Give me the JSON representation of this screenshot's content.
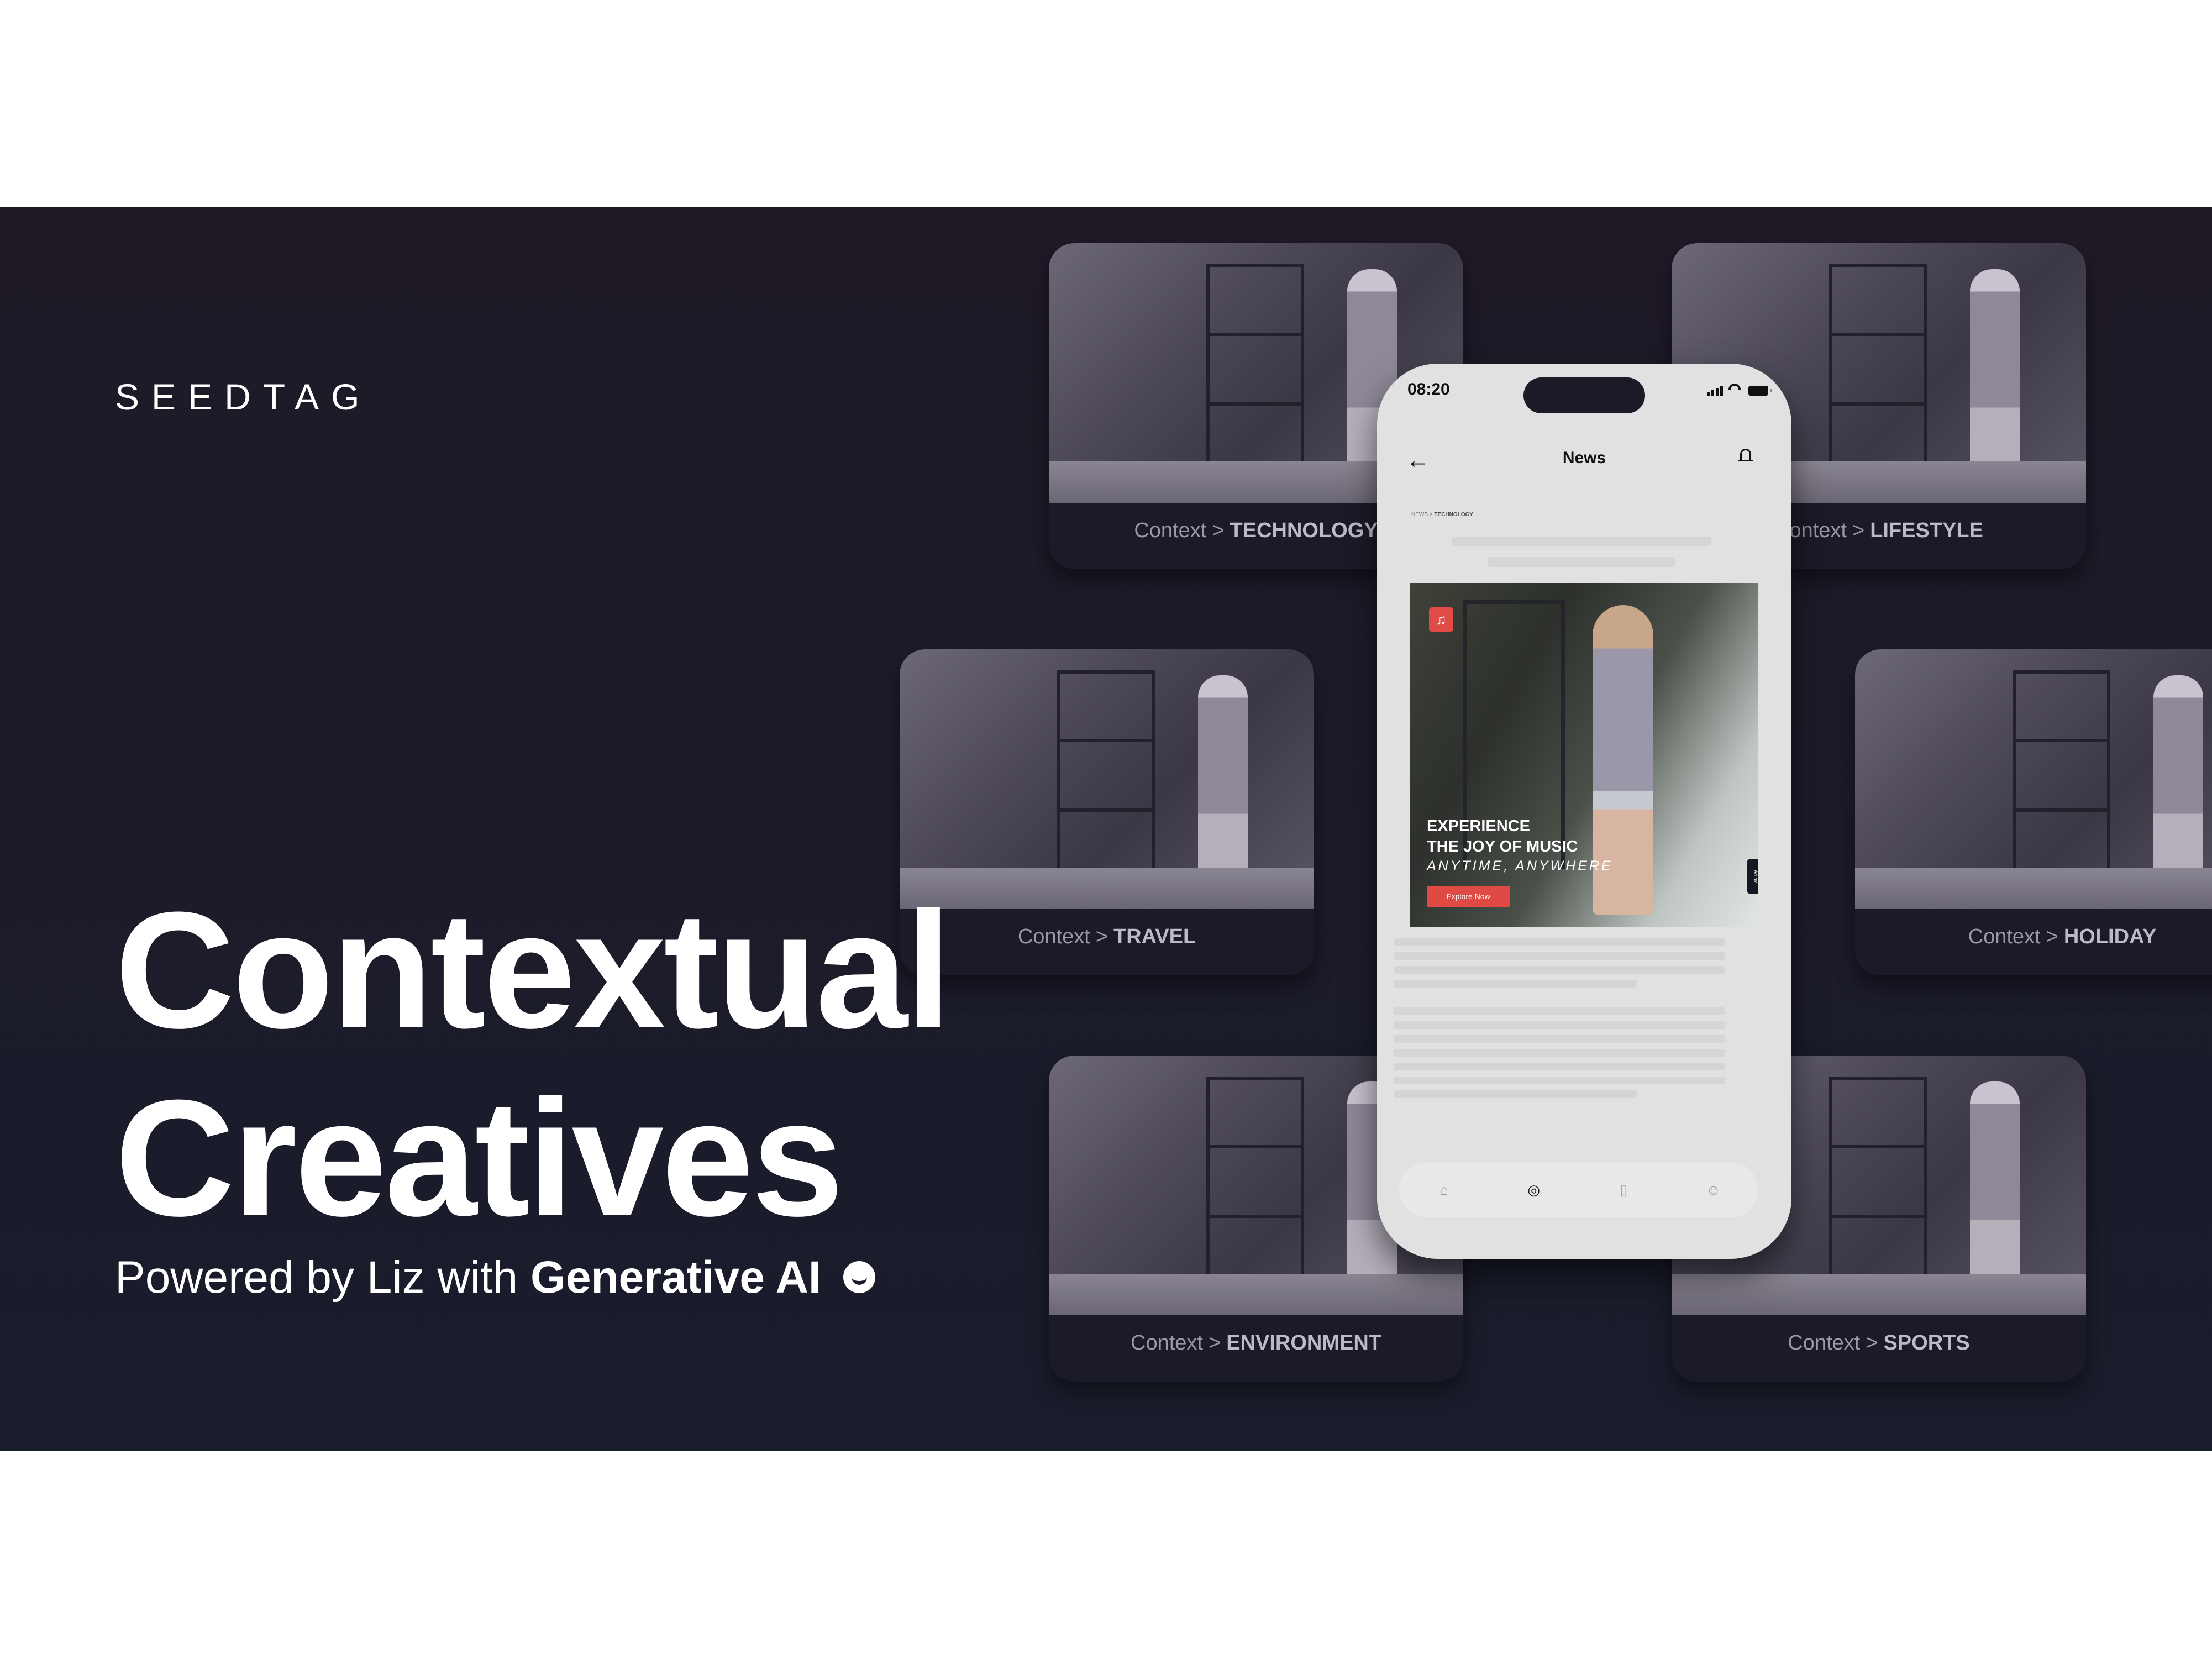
{
  "brand": {
    "logo": "SEEDTAG"
  },
  "hero": {
    "title_line1": "Contextual",
    "title_line2": "Creatives",
    "subtitle_light": "Powered by Liz with",
    "subtitle_bold": "Generative AI",
    "subtitle_icon": "liz-smile-icon"
  },
  "context_cards": [
    {
      "prefix": "Context",
      "separator": ">",
      "category": "TECHNOLOGY"
    },
    {
      "prefix": "Context",
      "separator": ">",
      "category": "LIFESTYLE"
    },
    {
      "prefix": "Context",
      "separator": ">",
      "category": "TRAVEL"
    },
    {
      "prefix": "Context",
      "separator": ">",
      "category": "HOLIDAY"
    },
    {
      "prefix": "Context",
      "separator": ">",
      "category": "ENVIRONMENT"
    },
    {
      "prefix": "Context",
      "separator": ">",
      "category": "SPORTS"
    }
  ],
  "phone": {
    "status": {
      "time": "08:20",
      "icons": [
        "signal-icon",
        "wifi-icon",
        "battery-icon"
      ]
    },
    "nav": {
      "back_icon": "arrow-left-icon",
      "title": "News",
      "notifications_icon": "bell-icon"
    },
    "breadcrumb": {
      "section": "NEWS",
      "separator": ">",
      "current": "TECHNOLOGY"
    },
    "ad": {
      "headline_line1": "EXPERIENCE",
      "headline_line2": "THE JOY OF MUSIC",
      "tagline": "ANYTIME, ANYWHERE",
      "cta_label": "Explore Now",
      "badge_label": "Ad by",
      "brand_icon": "music-note-icon",
      "accent_color": "#e14b45"
    },
    "tabbar": [
      {
        "icon": "home-icon",
        "active": false
      },
      {
        "icon": "compass-icon",
        "active": true
      },
      {
        "icon": "bookmark-icon",
        "active": false
      },
      {
        "icon": "profile-icon",
        "active": false
      }
    ]
  },
  "colors": {
    "background": "#1c1b2a",
    "text": "#ffffff",
    "card_label": "#bdbac7"
  }
}
